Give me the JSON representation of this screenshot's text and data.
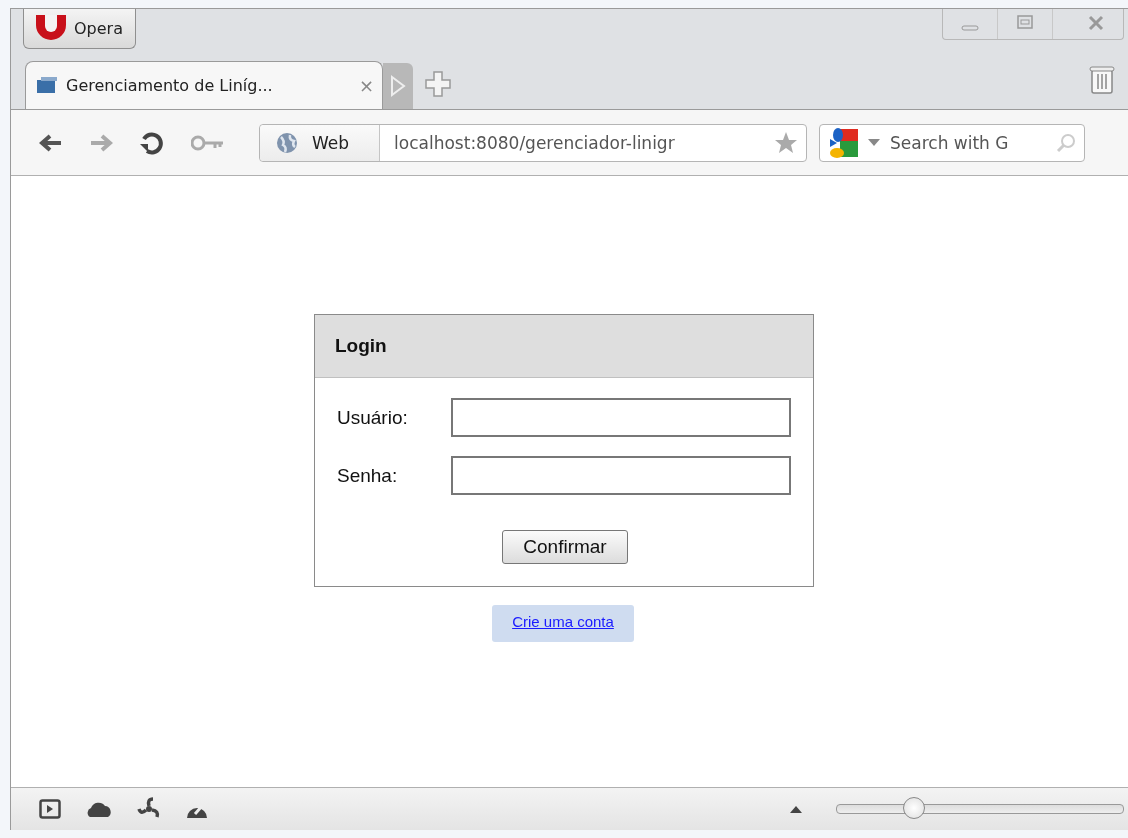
{
  "window": {
    "app_button": "Opera"
  },
  "tabs": [
    {
      "title": "Gerenciamento de Liníg...",
      "close": "×",
      "selected": true
    }
  ],
  "address_bar": {
    "mode": "Web",
    "url": "localhost:8080/gerenciador-linigr"
  },
  "search": {
    "placeholder": "Search with G"
  },
  "login": {
    "title": "Login",
    "fields": [
      {
        "label": "Usuário:"
      },
      {
        "label": "Senha:"
      }
    ],
    "button": "Confirmar",
    "link": "Crie uma conta"
  },
  "status_bar": {
    "zoom": {
      "level": 0.27
    }
  }
}
